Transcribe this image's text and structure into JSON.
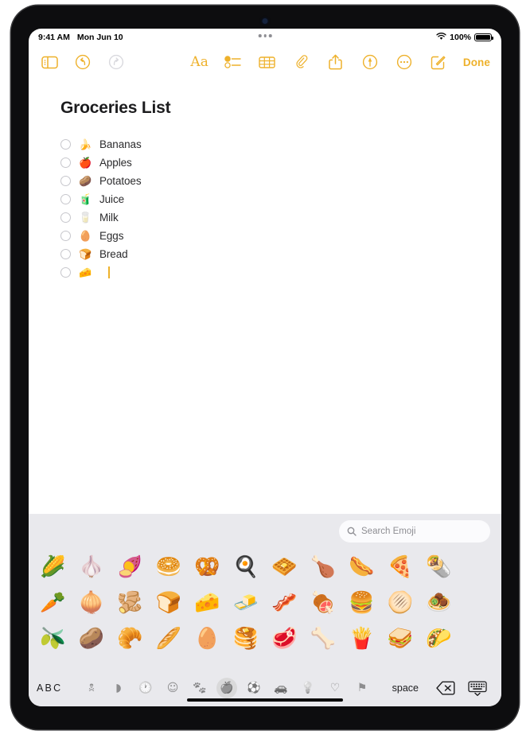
{
  "status_bar": {
    "time": "9:41 AM",
    "date": "Mon Jun 10",
    "battery_percent": "100%",
    "wifi_icon": "wifi-icon",
    "battery_icon": "battery-icon"
  },
  "toolbar": {
    "sidebar_icon": "sidebar-icon",
    "undo_icon": "undo-icon",
    "redo_icon": "redo-icon",
    "format_label": "Aa",
    "checklist_icon": "checklist-icon",
    "table_icon": "table-icon",
    "attachment_icon": "paperclip-icon",
    "share_icon": "share-icon",
    "markup_icon": "markup-icon",
    "more_icon": "more-ellipsis-icon",
    "compose_icon": "compose-icon",
    "done_label": "Done"
  },
  "note": {
    "title": "Groceries List",
    "checklist": [
      {
        "emoji": "🍌",
        "text": "Bananas",
        "checked": false
      },
      {
        "emoji": "🍎",
        "text": "Apples",
        "checked": false
      },
      {
        "emoji": "🥔",
        "text": "Potatoes",
        "checked": false
      },
      {
        "emoji": "🧃",
        "text": "Juice",
        "checked": false
      },
      {
        "emoji": "🥛",
        "text": "Milk",
        "checked": false
      },
      {
        "emoji": "🥚",
        "text": "Eggs",
        "checked": false
      },
      {
        "emoji": "🍞",
        "text": "Bread",
        "checked": false
      },
      {
        "emoji": "🧀",
        "text": "",
        "checked": false
      }
    ]
  },
  "keyboard": {
    "search": {
      "placeholder": "Search Emoji",
      "value": "",
      "icon": "search-icon"
    },
    "emoji_rows": [
      [
        "🌽",
        "🧄",
        "🍠",
        "🥯",
        "🥨",
        "🍳",
        "🧇",
        "🍗",
        "🌭",
        "🍕",
        "🌯"
      ],
      [
        "🥕",
        "🧅",
        "🫚",
        "🍞",
        "🧀",
        "🧈",
        "🥓",
        "🍖",
        "🍔",
        "🫓",
        "🧆"
      ],
      [
        "🫒",
        "🥔",
        "🥐",
        "🥖",
        "🥚",
        "🥞",
        "🥩",
        "🦴",
        "🍟",
        "🥪",
        "🌮"
      ]
    ],
    "abc_label": "ABC",
    "categories": [
      {
        "name": "recents",
        "glyph": "🕱",
        "selected": false
      },
      {
        "name": "emoji-stickers",
        "glyph": "◗",
        "selected": false
      },
      {
        "name": "frequently-used",
        "glyph": "🕐",
        "selected": false
      },
      {
        "name": "smileys-people",
        "glyph": "☺",
        "selected": false
      },
      {
        "name": "animals-nature",
        "glyph": "🐾",
        "selected": false
      },
      {
        "name": "food-drink",
        "glyph": "🍎",
        "selected": true
      },
      {
        "name": "activity",
        "glyph": "⚽",
        "selected": false
      },
      {
        "name": "travel-places",
        "glyph": "🚗",
        "selected": false
      },
      {
        "name": "objects",
        "glyph": "💡",
        "selected": false
      },
      {
        "name": "symbols",
        "glyph": "♡",
        "selected": false
      },
      {
        "name": "flags",
        "glyph": "⚑",
        "selected": false
      }
    ],
    "space_label": "space",
    "delete_icon": "delete-backward-icon",
    "dismiss_icon": "dismiss-keyboard-icon"
  },
  "colors": {
    "accent": "#eeb12b",
    "keyboard_bg": "#e9e9ed",
    "note_bg": "#ffffff"
  }
}
